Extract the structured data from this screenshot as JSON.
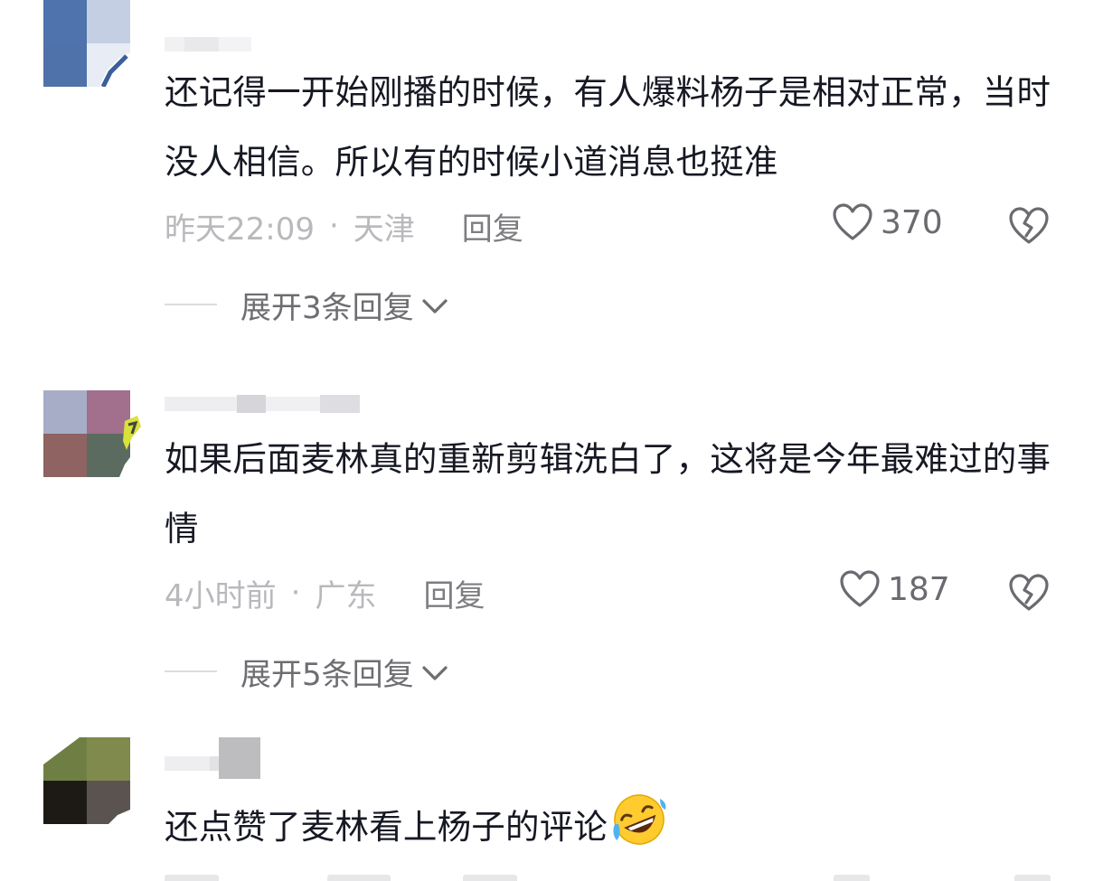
{
  "comments": [
    {
      "text": "还记得一开始刚播的时候，有人爆料杨子是相对正常，当时没人相信。所以有的时候小道消息也挺准",
      "time": "昨天22:09",
      "dot": "·",
      "location": "天津",
      "reply_label": "回复",
      "likes": "370",
      "expand_label": "展开3条回复"
    },
    {
      "text": "如果后面麦林真的重新剪辑洗白了，这将是今年最难过的事情",
      "time": "4小时前",
      "dot": "·",
      "location": "广东",
      "reply_label": "回复",
      "likes": "187",
      "expand_label": "展开5条回复"
    },
    {
      "text": "还点赞了麦林看上杨子的评论",
      "emoji": "rolling-on-floor-laughing"
    }
  ],
  "icons": {
    "like": "heart-outline-icon",
    "dislike": "broken-heart-icon",
    "expand": "chevron-down-icon"
  },
  "colors": {
    "text_primary": "#161823",
    "text_meta": "#b9b9bd",
    "text_secondary": "#6d6d72"
  }
}
